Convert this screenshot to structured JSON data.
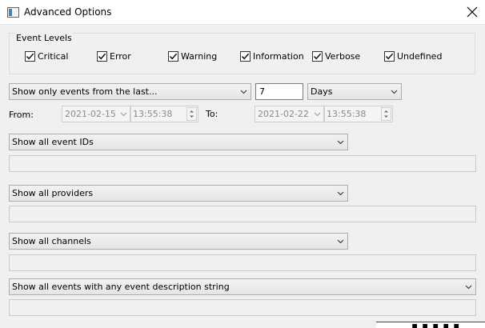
{
  "window": {
    "title": "Advanced Options"
  },
  "event_levels": {
    "legend": "Event Levels",
    "items": [
      {
        "label": "Critical",
        "checked": true
      },
      {
        "label": "Error",
        "checked": true
      },
      {
        "label": "Warning",
        "checked": true
      },
      {
        "label": "Information",
        "checked": true
      },
      {
        "label": "Verbose",
        "checked": true
      },
      {
        "label": "Undefined",
        "checked": true
      }
    ]
  },
  "time_filter": {
    "mode": "Show only events from the last...",
    "amount": "7",
    "unit": "Days",
    "from_label": "From:",
    "from_date": "2021-02-15",
    "from_time": "13:55:38",
    "to_label": "To:",
    "to_date": "2021-02-22",
    "to_time": "13:55:38"
  },
  "event_ids": {
    "selected": "Show all event IDs",
    "value": ""
  },
  "providers": {
    "selected": "Show all providers",
    "value": ""
  },
  "channels": {
    "selected": "Show all channels",
    "value": ""
  },
  "description": {
    "selected": "Show all events with any event description string",
    "value": ""
  }
}
